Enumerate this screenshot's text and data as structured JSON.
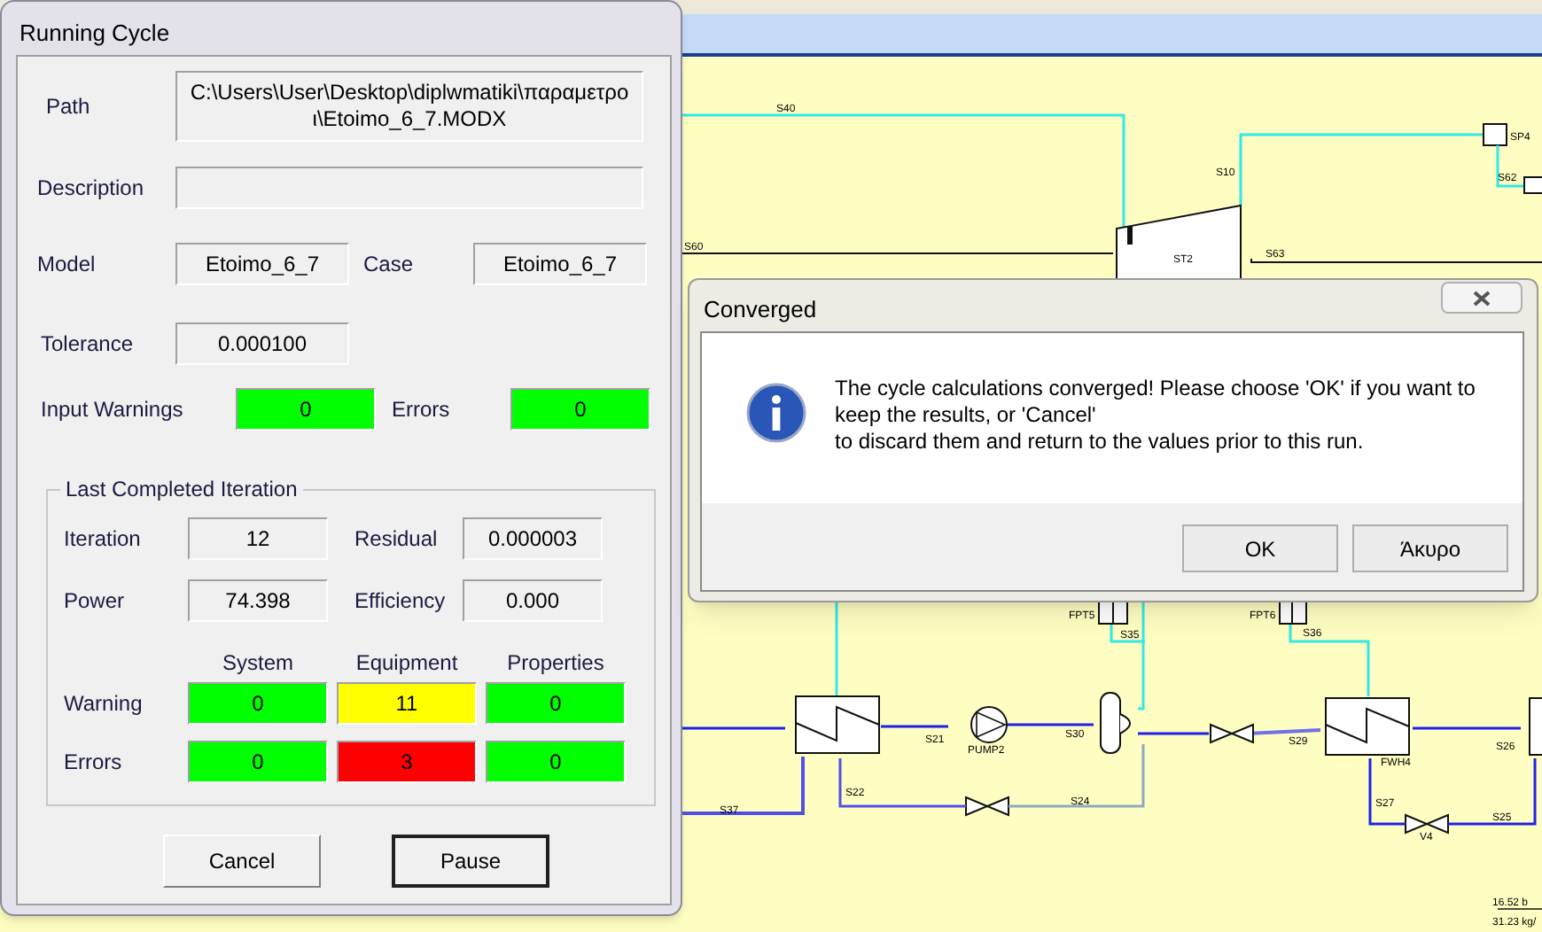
{
  "running_cycle": {
    "title": "Running Cycle",
    "path": {
      "label": "Path",
      "value": "C:\\Users\\User\\Desktop\\diplwmatiki\\παραμετροι\\Etoimo_6_7.MODX"
    },
    "description": {
      "label": "Description"
    },
    "model": {
      "label": "Model",
      "value": "Etoimo_6_7"
    },
    "case": {
      "label": "Case",
      "value": "Etoimo_6_7"
    },
    "tolerance": {
      "label": "Tolerance",
      "value": "0.000100"
    },
    "input_warnings": {
      "label": "Input Warnings",
      "value": "0",
      "color": "#00ff00"
    },
    "input_errors": {
      "label": "Errors",
      "value": "0",
      "color": "#00ff00"
    },
    "last_iteration": {
      "title": "Last Completed Iteration",
      "fields": [
        {
          "label": "Iteration",
          "value": "12"
        },
        {
          "label": "Residual",
          "value": "0.000003"
        },
        {
          "label": "Power",
          "value": "74.398"
        },
        {
          "label": "Efficiency",
          "value": "0.000"
        }
      ],
      "columns": [
        "System",
        "Equipment",
        "Properties"
      ],
      "rows": [
        {
          "label": "Warning",
          "cells": [
            {
              "value": "0",
              "color": "#00ff00"
            },
            {
              "value": "11",
              "color": "#ffff00"
            },
            {
              "value": "0",
              "color": "#00ff00"
            }
          ]
        },
        {
          "label": "Errors",
          "cells": [
            {
              "value": "0",
              "color": "#00ff00"
            },
            {
              "value": "3",
              "color": "#ff0000"
            },
            {
              "value": "0",
              "color": "#00ff00"
            }
          ]
        }
      ]
    },
    "buttons": [
      {
        "label": "Cancel",
        "default": false
      },
      {
        "label": "Pause",
        "default": true
      }
    ]
  },
  "converged_dialog": {
    "title": "Converged",
    "message": "The cycle calculations converged! Please choose 'OK' if you want to\nkeep the results, or 'Cancel'\nto discard them and return to the values prior to this run.",
    "buttons": [
      {
        "label": "OK"
      },
      {
        "label": "Άκυρο"
      }
    ]
  },
  "diagram": {
    "labels": [
      {
        "text": "S40"
      },
      {
        "text": "S10"
      },
      {
        "text": "S60"
      },
      {
        "text": "ST2"
      },
      {
        "text": "S63"
      },
      {
        "text": "SP4"
      },
      {
        "text": "S62"
      },
      {
        "text": "FPT5"
      },
      {
        "text": "S35"
      },
      {
        "text": "FPT6"
      },
      {
        "text": "S36"
      },
      {
        "text": "S21"
      },
      {
        "text": "PUMP2"
      },
      {
        "text": "S30"
      },
      {
        "text": "S29"
      },
      {
        "text": "FWH4"
      },
      {
        "text": "S26"
      },
      {
        "text": "S22"
      },
      {
        "text": "S24"
      },
      {
        "text": "S37"
      },
      {
        "text": "S27"
      },
      {
        "text": "V4"
      },
      {
        "text": "S25"
      },
      {
        "text": "16.52 b"
      },
      {
        "text": "31.23 kg/"
      }
    ]
  }
}
